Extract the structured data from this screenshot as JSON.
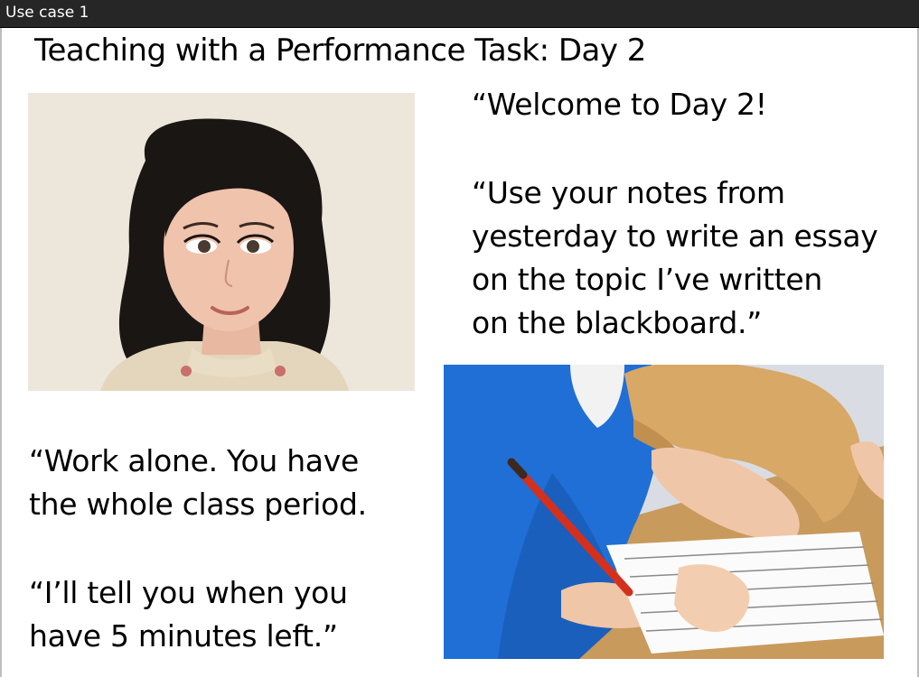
{
  "window": {
    "title": "Use case 1"
  },
  "slide": {
    "title": "Teaching with a Performance Task: Day 2",
    "quote_top": {
      "lines": [
        "“Welcome to Day 2!"
      ],
      "lines2": [
        "“Use your notes from",
        "yesterday to write an essay",
        "on the topic I’ve written",
        "on the blackboard.”"
      ]
    },
    "quote_bottom": {
      "lines": [
        "“Work alone. You have",
        "the whole class period."
      ],
      "lines2": [
        "“I’ll tell you when you",
        "have 5 minutes left.”"
      ]
    }
  },
  "images": {
    "teacher": {
      "icon": "teacher-cartoon-portrait"
    },
    "student": {
      "icon": "student-writing-photo"
    }
  },
  "colors": {
    "titlebar": "#262626",
    "teacher_bg": "#ede6db",
    "student_shirt": "#1f6fd6",
    "desk": "#c89a5c"
  }
}
